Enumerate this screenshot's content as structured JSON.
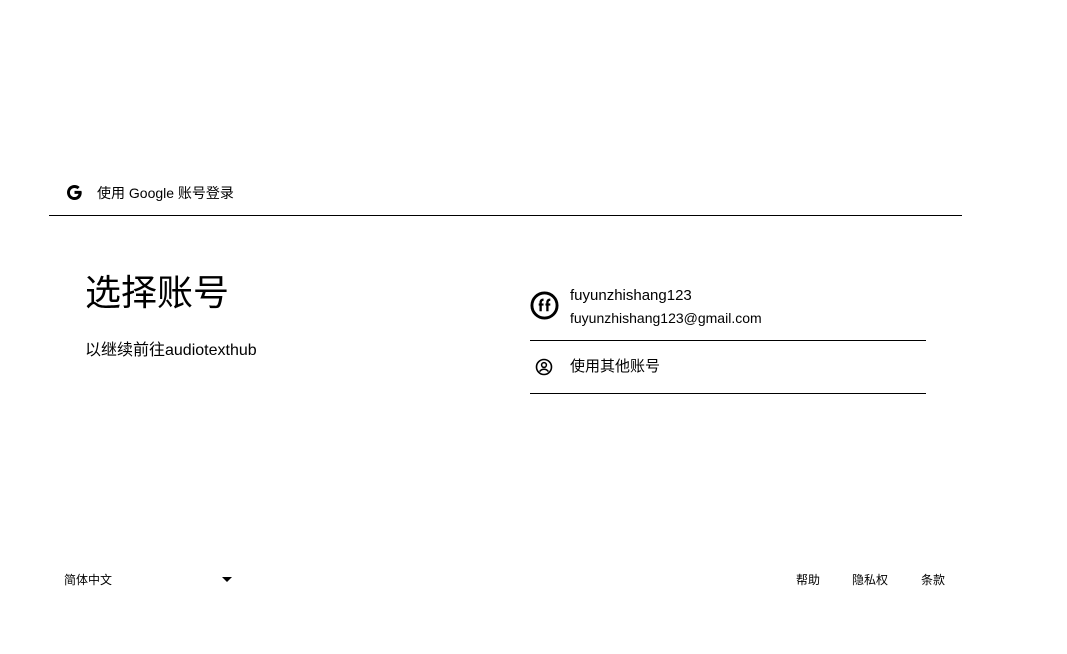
{
  "header": {
    "logo_icon": "google-g-logo-icon",
    "title": "使用 Google 账号登录"
  },
  "main": {
    "title": "选择账号",
    "subtitle": "以继续前往audiotexthub"
  },
  "accounts": [
    {
      "avatar_icon": "avatar-icon",
      "name": "fuyunzhishang123",
      "email": "fuyunzhishang123@gmail.com"
    }
  ],
  "other_account": {
    "icon": "person-circle-icon",
    "label": "使用其他账号"
  },
  "footer": {
    "language": "简体中文",
    "links": {
      "help": "帮助",
      "privacy": "隐私权",
      "terms": "条款"
    }
  }
}
